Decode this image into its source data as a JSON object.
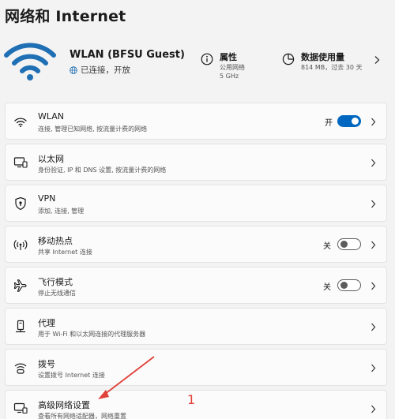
{
  "page": {
    "title": "网络和 Internet"
  },
  "hero": {
    "network_name": "WLAN (BFSU Guest)",
    "status": "已连接，开放",
    "properties": {
      "label": "属性",
      "line1": "公用网络",
      "line2": "5 GHz"
    },
    "data_usage": {
      "label": "数据使用量",
      "line1": "814 MB，过去 30 天"
    }
  },
  "cards": [
    {
      "title": "WLAN",
      "desc": "连接, 管理已知网络, 按流量计费的网络",
      "icon": "wifi-icon",
      "toggle": {
        "label": "开",
        "on": true
      }
    },
    {
      "title": "以太网",
      "desc": "身份验证, IP 和 DNS 设置, 按流量计费的网络",
      "icon": "ethernet-icon"
    },
    {
      "title": "VPN",
      "desc": "添加, 连接, 管理",
      "icon": "vpn-shield-icon"
    },
    {
      "title": "移动热点",
      "desc": "共享 Internet 连接",
      "icon": "hotspot-icon",
      "toggle": {
        "label": "关",
        "on": false
      }
    },
    {
      "title": "飞行模式",
      "desc": "停止无线通信",
      "icon": "airplane-icon",
      "toggle": {
        "label": "关",
        "on": false
      }
    },
    {
      "title": "代理",
      "desc": "用于 Wi-Fi 和以太网连接的代理服务器",
      "icon": "proxy-icon"
    },
    {
      "title": "拨号",
      "desc": "设置拨号 Internet 连接",
      "icon": "dialup-icon"
    },
    {
      "title": "高级网络设置",
      "desc": "查看所有网络适配器，网络重置",
      "icon": "advanced-network-icon"
    }
  ],
  "annotation": {
    "number": "1"
  },
  "colors": {
    "accent": "#0067c0",
    "annotation": "#e0413a",
    "wifi_hero": "#1f6fb5"
  }
}
